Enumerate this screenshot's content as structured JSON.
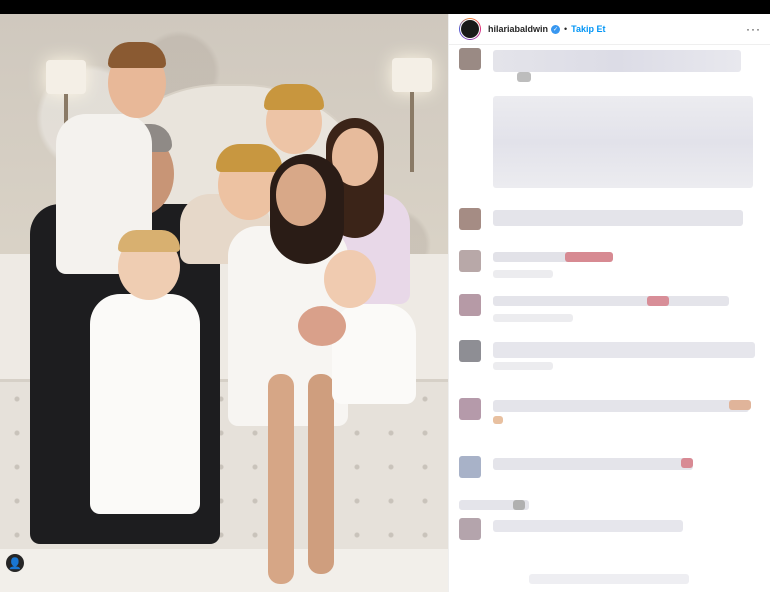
{
  "post": {
    "username": "hilariabaldwin",
    "separator": "•",
    "follow_label": "Takip Et",
    "more_glyph": "···",
    "verified_glyph": "✓",
    "tag_glyph": "👤"
  },
  "icons": {
    "verified": "verified-badge-icon",
    "more": "more-options-icon",
    "user_tag": "user-tag-icon"
  },
  "colors": {
    "follow": "#0095f6",
    "verified": "#3897f0",
    "text": "#262626"
  }
}
